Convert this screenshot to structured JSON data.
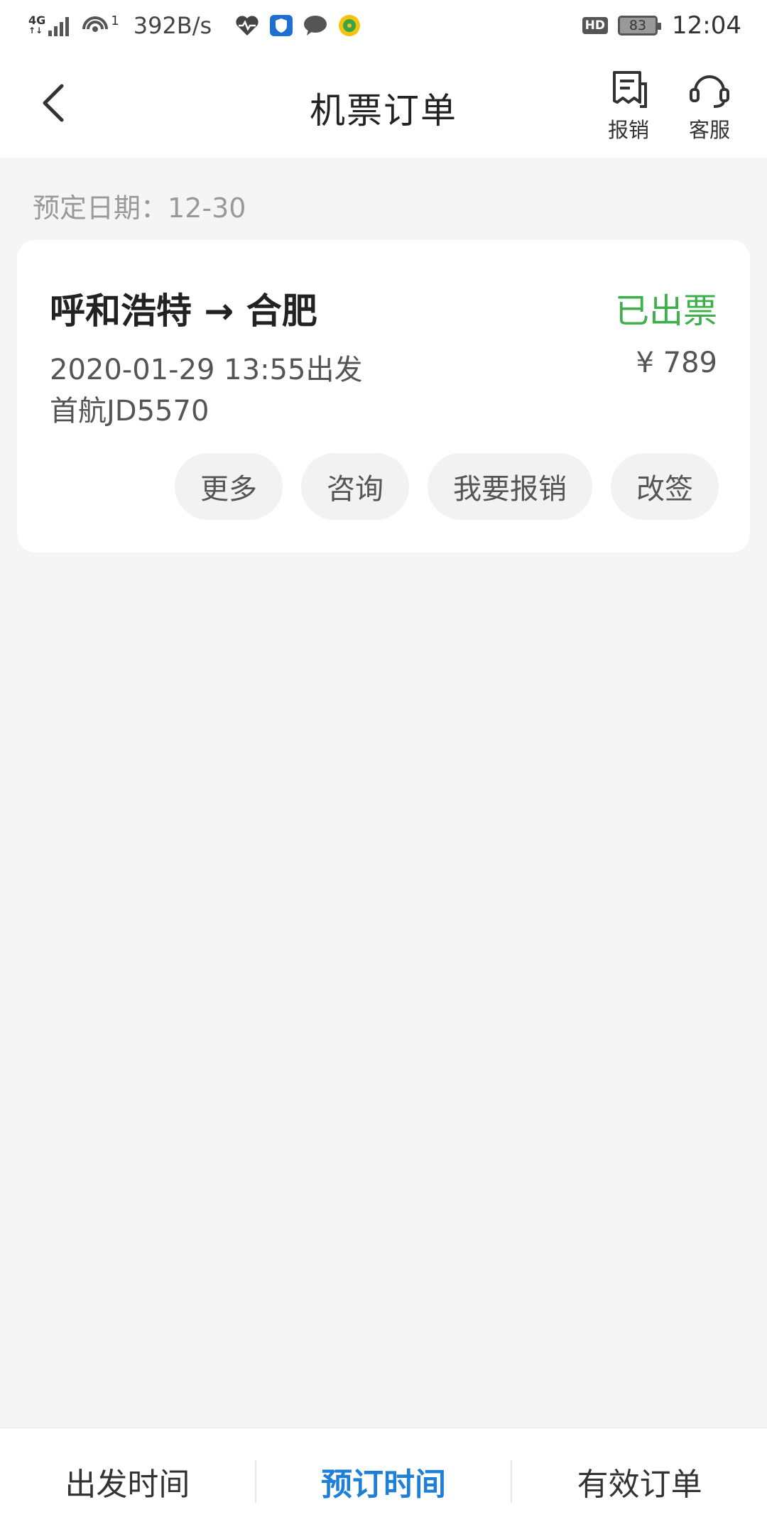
{
  "status_bar": {
    "network": "4G",
    "hotspot_count": "1",
    "speed": "392B/s",
    "hd": "HD",
    "battery": "83",
    "time": "12:04",
    "icons": [
      "signal-icon",
      "wifi-hotspot-icon",
      "health-icon",
      "shield-app-icon",
      "message-icon",
      "music-app-icon"
    ]
  },
  "header": {
    "title": "机票订单",
    "reimburse_label": "报销",
    "service_label": "客服"
  },
  "date_row": {
    "label": "预定日期：12-30"
  },
  "order": {
    "route": "呼和浩特 → 合肥",
    "status": "已出票",
    "status_color": "#3db04b",
    "departure": "2020-01-29 13:55出发",
    "price": "¥ 789",
    "flight": "首航JD5570",
    "actions": [
      "更多",
      "咨询",
      "我要报销",
      "改签"
    ]
  },
  "bottom_tabs": {
    "tabs": [
      {
        "label": "出发时间",
        "active": false
      },
      {
        "label": "预订时间",
        "active": true
      },
      {
        "label": "有效订单",
        "active": false
      }
    ],
    "accent_color": "#1e7fd8"
  }
}
